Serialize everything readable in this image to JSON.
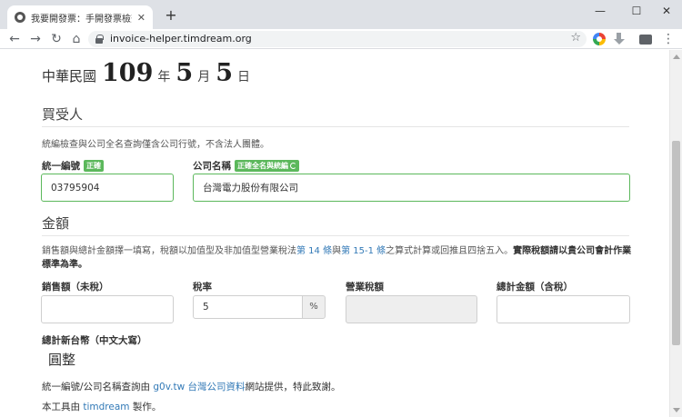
{
  "browser": {
    "tab_title": "我要開發票：手開發票檢查小幫手",
    "new_tab_label": "+",
    "window_controls": {
      "minimize": "—",
      "maximize": "☐",
      "close": "✕"
    },
    "url": "invoice-helper.timdream.org",
    "icons": {
      "back": "arrow-left-icon",
      "forward": "arrow-right-icon",
      "reload": "reload-icon",
      "secure": "lock-icon",
      "bookmark": "star-icon",
      "menu": "kebab-menu-icon"
    }
  },
  "date": {
    "era": "中華民國",
    "year": "109",
    "year_unit": "年",
    "month": "5",
    "month_unit": "月",
    "day": "5",
    "day_unit": "日"
  },
  "buyer": {
    "section_title": "買受人",
    "help": "統編檢查與公司全名查詢僅含公司行號，不含法人團體。",
    "tax_id": {
      "label": "統一編號",
      "badge": "正確",
      "value": "03795904"
    },
    "company": {
      "label": "公司名稱",
      "badge": "正確全名與統編",
      "value": "台灣電力股份有限公司"
    }
  },
  "amount": {
    "section_title": "金額",
    "help_pre": "銷售額與總計金額擇一填寫，稅額以加值型及非加值型營業稅法",
    "link1": "第 14 條",
    "help_mid": "與",
    "link2": "第 15-1 條",
    "help_post": "之算式計算或回推且四捨五入。",
    "help_bold": "實際稅額請以貴公司會計作業標準為準。",
    "sales": {
      "label": "銷售額（未稅）",
      "value": ""
    },
    "tax_rate": {
      "label": "稅率",
      "value": "5",
      "unit": "%"
    },
    "tax": {
      "label": "營業稅額",
      "value": ""
    },
    "total": {
      "label": "總計金額（含稅）",
      "value": ""
    },
    "chinese_total": {
      "label": "總計新台幣（中文大寫）",
      "value": "圓整"
    }
  },
  "footer": {
    "credit_pre": "統一編號/公司名稱查詢由 ",
    "credit_link": "g0v.tw 台灣公司資料",
    "credit_post": "網站提供，特此致謝。",
    "author_pre": "本工具由 ",
    "author_link": "timdream",
    "author_post": " 製作。"
  },
  "colors": {
    "ok": "#5cb85c",
    "link": "#337ab7"
  }
}
